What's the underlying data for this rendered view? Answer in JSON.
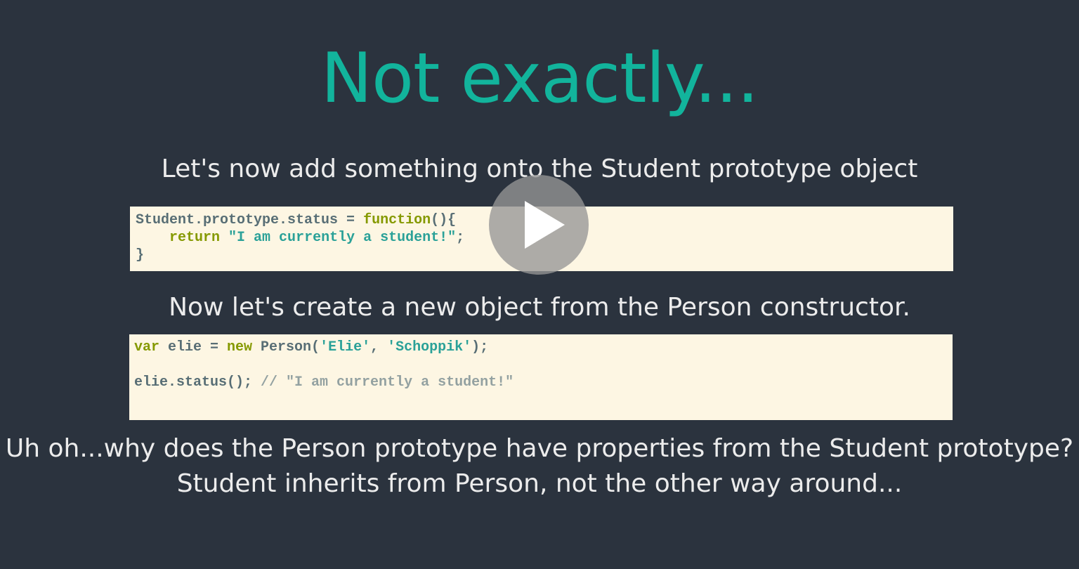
{
  "slide": {
    "title": "Not exactly...",
    "intro": "Let's now add something onto the Student prototype object",
    "middle": "Now let's create a new object from the Person constructor.",
    "closing": "Uh oh...why does the Person prototype have properties from the Student prototype? Student inherits from Person, not the other way around..."
  },
  "code1": {
    "line1_prefix": "Student.prototype.status = ",
    "line1_keyword": "function",
    "line1_suffix": "(){",
    "line2_indent": "    ",
    "line2_keyword": "return",
    "line2_space": " ",
    "line2_string": "\"I am currently a student!\"",
    "line2_suffix": ";",
    "line3": "}"
  },
  "code2": {
    "line1_kw1": "var",
    "line1_text1": " elie = ",
    "line1_kw2": "new",
    "line1_text2": " Person(",
    "line1_str1": "'Elie'",
    "line1_text3": ", ",
    "line1_str2": "'Schoppik'",
    "line1_text4": ");",
    "line2_code": "elie.status(); ",
    "line2_comment": "// \"I am currently a student!\""
  },
  "video": {
    "play_icon": "play-icon",
    "overlay_color": "#969696"
  }
}
